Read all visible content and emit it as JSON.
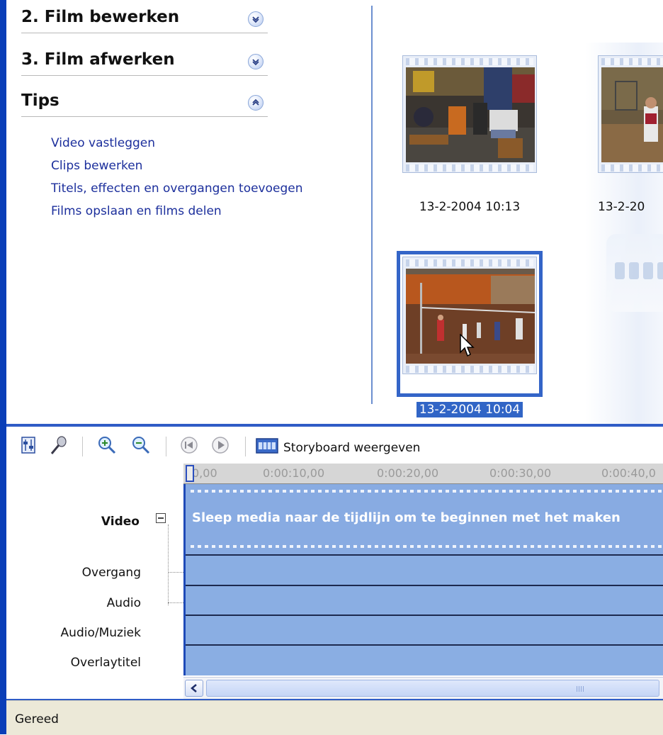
{
  "taskpane": {
    "sections": [
      {
        "title": "2. Film bewerken",
        "state": "collapsed"
      },
      {
        "title": "3. Film afwerken",
        "state": "collapsed"
      },
      {
        "title": "Tips",
        "state": "expanded"
      }
    ],
    "tips_links": [
      "Video vastleggen",
      "Clips bewerken",
      "Titels, effecten en overgangen toevoegen",
      "Films opslaan en films delen"
    ]
  },
  "collection": {
    "clips": [
      {
        "caption": "13-2-2004 10:13",
        "selected": false
      },
      {
        "caption": "13-2-20",
        "selected": false
      },
      {
        "caption": "13-2-2004 10:04",
        "selected": true
      }
    ]
  },
  "toolbar": {
    "icons": [
      "set-audio-levels-icon",
      "narrate-timeline-icon",
      "zoom-in-icon",
      "zoom-out-icon",
      "rewind-icon",
      "play-icon",
      "storyboard-icon"
    ],
    "storyboard_label": "Storyboard weergeven"
  },
  "timeline": {
    "ruler_ticks": [
      "0,00",
      "0:00:10,00",
      "0:00:20,00",
      "0:00:30,00",
      "0:00:40,0"
    ],
    "tracks": {
      "video": "Video",
      "transition": "Overgang",
      "audio": "Audio",
      "audio_music": "Audio/Muziek",
      "title_overlay": "Overlaytitel"
    },
    "drop_message": "Sleep media naar de tijdlijn om te beginnen met het maken"
  },
  "status": {
    "text": "Gereed"
  },
  "colors": {
    "window_border": "#0a3eb8",
    "link": "#1c2f9c",
    "track_fill": "#8aaee3",
    "selection": "#3165c6",
    "status_bar": "#ece9d8"
  }
}
